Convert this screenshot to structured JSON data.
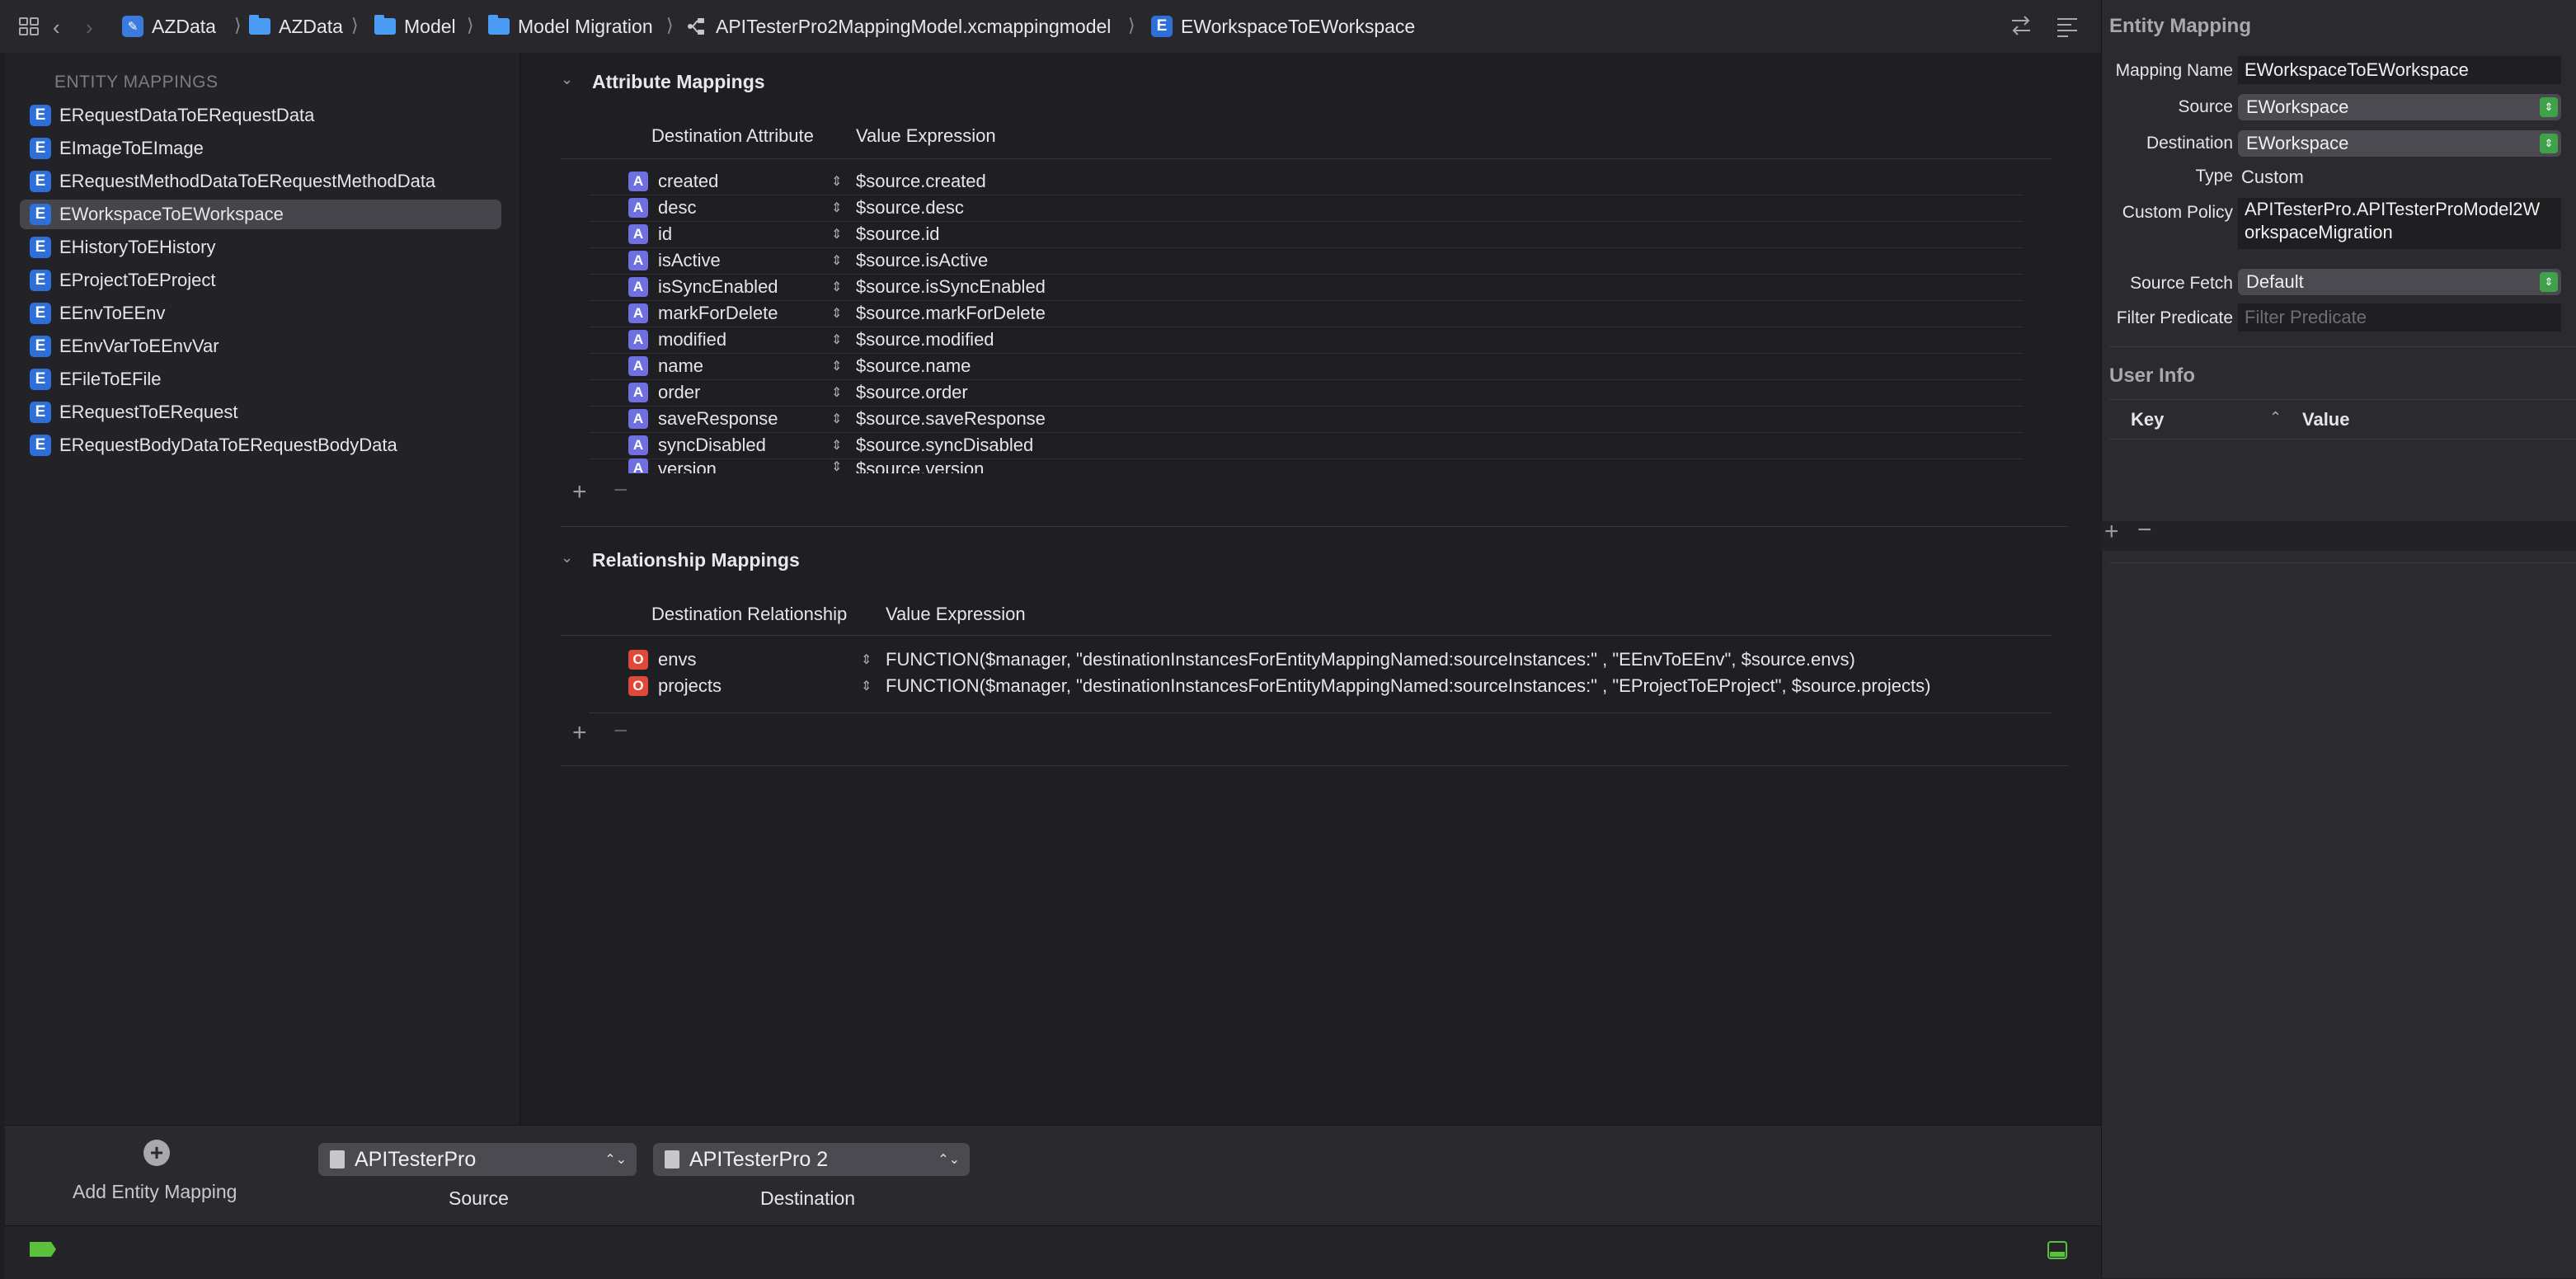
{
  "breadcrumb": [
    {
      "label": "AZData",
      "icon": "project-icon"
    },
    {
      "label": "AZData",
      "icon": "folder-icon"
    },
    {
      "label": "Model",
      "icon": "folder-icon"
    },
    {
      "label": "Model Migration",
      "icon": "folder-icon"
    },
    {
      "label": "APITesterPro2MappingModel.xcmappingmodel",
      "icon": "mapping-model-icon"
    },
    {
      "label": "EWorkspaceToEWorkspace",
      "icon": "entity-icon"
    }
  ],
  "sidebar": {
    "header": "ENTITY MAPPINGS",
    "items": [
      "ERequestDataToERequestData",
      "EImageToEImage",
      "ERequestMethodDataToERequestMethodData",
      "EWorkspaceToEWorkspace",
      "EHistoryToEHistory",
      "EProjectToEProject",
      "EEnvToEEnv",
      "EEnvVarToEEnvVar",
      "EFileToEFile",
      "ERequestToERequest",
      "ERequestBodyDataToERequestBodyData"
    ],
    "badge": "E",
    "selected_index": 3
  },
  "attribute_mappings": {
    "title": "Attribute Mappings",
    "col_destination": "Destination Attribute",
    "col_value": "Value Expression",
    "badge": "A",
    "rows": [
      {
        "name": "created",
        "expr": "$source.created"
      },
      {
        "name": "desc",
        "expr": "$source.desc"
      },
      {
        "name": "id",
        "expr": "$source.id"
      },
      {
        "name": "isActive",
        "expr": "$source.isActive"
      },
      {
        "name": "isSyncEnabled",
        "expr": "$source.isSyncEnabled"
      },
      {
        "name": "markForDelete",
        "expr": "$source.markForDelete"
      },
      {
        "name": "modified",
        "expr": "$source.modified"
      },
      {
        "name": "name",
        "expr": "$source.name"
      },
      {
        "name": "order",
        "expr": "$source.order"
      },
      {
        "name": "saveResponse",
        "expr": "$source.saveResponse"
      },
      {
        "name": "syncDisabled",
        "expr": "$source.syncDisabled"
      },
      {
        "name": "version",
        "expr": "$source.version"
      }
    ]
  },
  "relationship_mappings": {
    "title": "Relationship Mappings",
    "col_destination": "Destination Relationship",
    "col_value": "Value Expression",
    "badge": "O",
    "rows": [
      {
        "name": "envs",
        "expr": "FUNCTION($manager, \"destinationInstancesForEntityMappingNamed:sourceInstances:\" , \"EEnvToEEnv\", $source.envs)"
      },
      {
        "name": "projects",
        "expr": "FUNCTION($manager, \"destinationInstancesForEntityMappingNamed:sourceInstances:\" , \"EProjectToEProject\", $source.projects)"
      }
    ]
  },
  "bottom": {
    "add_entity_mapping": "Add Entity Mapping",
    "source_value": "APITesterPro",
    "source_label": "Source",
    "destination_value": "APITesterPro 2",
    "destination_label": "Destination"
  },
  "inspector": {
    "title": "Entity Mapping",
    "mapping_name_label": "Mapping Name",
    "mapping_name": "EWorkspaceToEWorkspace",
    "source_label": "Source",
    "source": "EWorkspace",
    "destination_label": "Destination",
    "destination": "EWorkspace",
    "type_label": "Type",
    "type": "Custom",
    "custom_policy_label": "Custom Policy",
    "custom_policy_line1": "APITesterPro.APITesterProModel2W",
    "custom_policy_line2": "orkspaceMigration",
    "source_fetch_label": "Source Fetch",
    "source_fetch": "Default",
    "filter_predicate_label": "Filter Predicate",
    "filter_predicate_placeholder": "Filter Predicate",
    "user_info_title": "User Info",
    "col_key": "Key",
    "col_value": "Value"
  },
  "colors": {
    "accent": "#2e6fd9",
    "attribute_badge": "#6f6fe0",
    "relationship_badge": "#e0483a",
    "select_indicator": "#3fa14a"
  }
}
